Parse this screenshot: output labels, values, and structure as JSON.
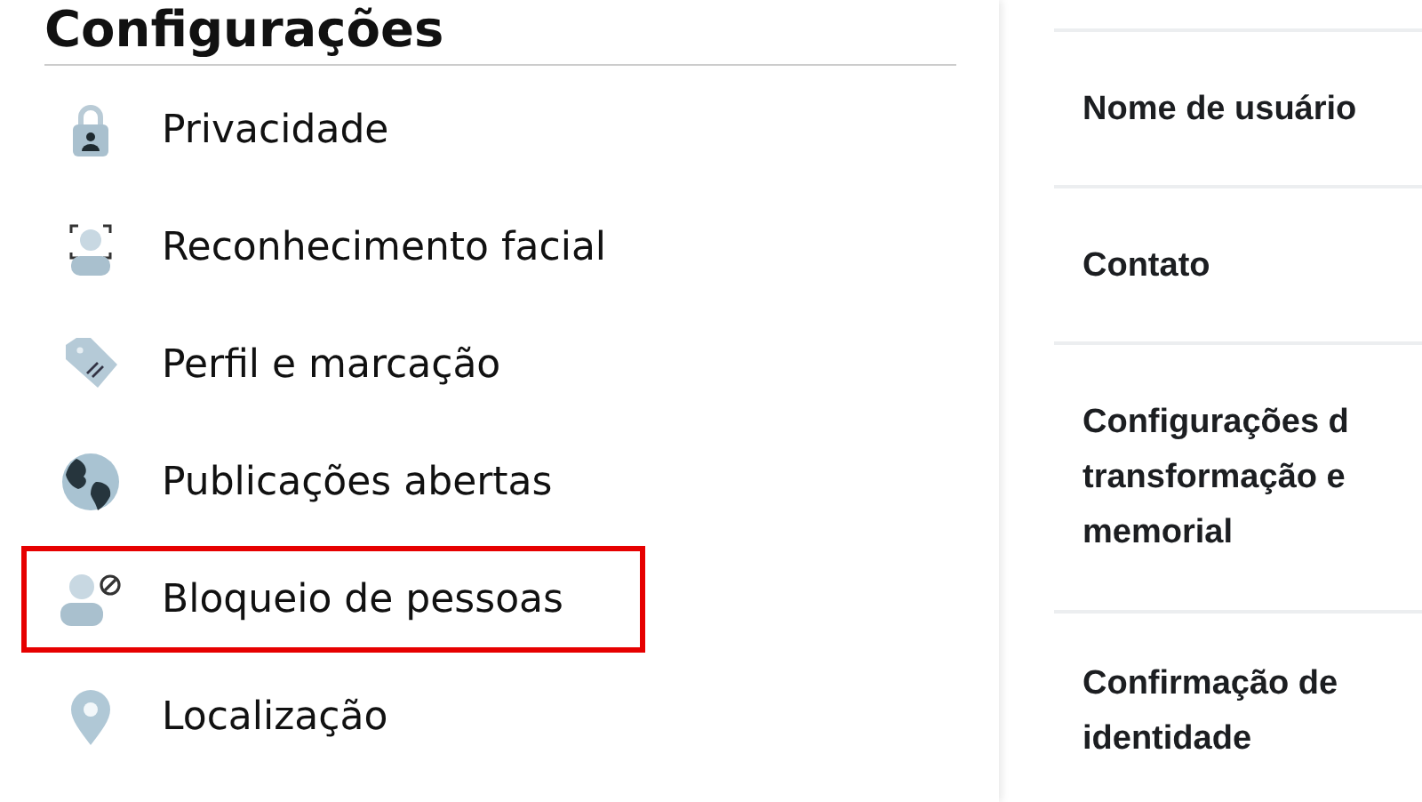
{
  "heading": "Configurações",
  "menu": [
    {
      "label": "Privacidade",
      "highlighted": false
    },
    {
      "label": "Reconhecimento facial",
      "highlighted": false
    },
    {
      "label": "Perfil e marcação",
      "highlighted": false
    },
    {
      "label": "Publicações abertas",
      "highlighted": false
    },
    {
      "label": "Bloqueio de pessoas",
      "highlighted": true
    },
    {
      "label": "Localização",
      "highlighted": false
    }
  ],
  "details": [
    {
      "lines": [
        "Nome de usuário"
      ]
    },
    {
      "lines": [
        "Contato"
      ]
    },
    {
      "lines": [
        "Configurações d",
        "transformação e",
        "memorial"
      ]
    },
    {
      "lines": [
        "Confirmação de",
        "identidade"
      ]
    }
  ]
}
